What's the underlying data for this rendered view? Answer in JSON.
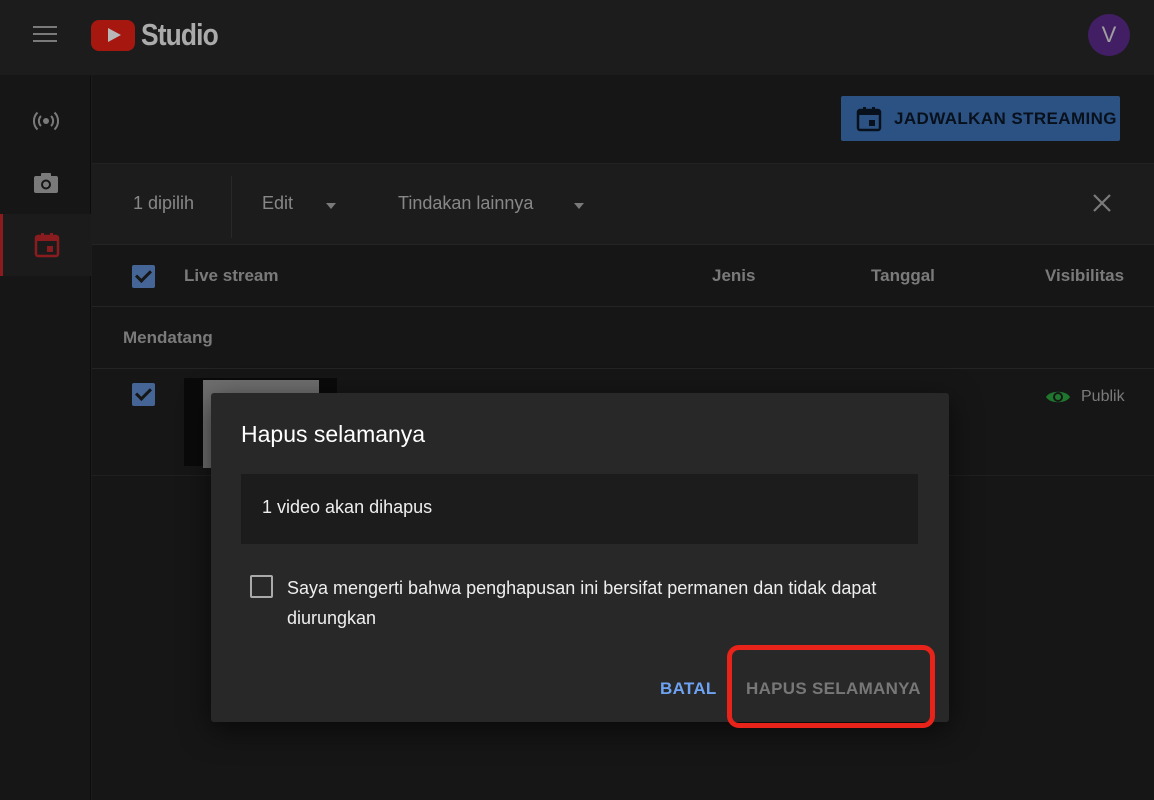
{
  "header": {
    "app_name": "Studio",
    "avatar_initial": "V"
  },
  "rail": {
    "items": [
      {
        "icon": "live-broadcast-icon"
      },
      {
        "icon": "camera-icon"
      },
      {
        "icon": "calendar-icon",
        "active": true
      }
    ]
  },
  "content": {
    "schedule_button": "JADWALKAN STREAMING",
    "toolbar": {
      "selected_count": "1 dipilih",
      "edit": "Edit",
      "more_actions": "Tindakan lainnya"
    },
    "table": {
      "headers": {
        "live_stream": "Live stream",
        "type": "Jenis",
        "date": "Tanggal",
        "visibility": "Visibilitas"
      },
      "section": "Mendatang",
      "row": {
        "visibility": "Publik"
      }
    }
  },
  "dialog": {
    "title": "Hapus selamanya",
    "info": "1 video akan dihapus",
    "confirm_text": "Saya mengerti bahwa penghapusan ini bersifat permanen dan tidak dapat diurungkan",
    "cancel": "BATAL",
    "delete": "HAPUS SELAMANYA"
  },
  "colors": {
    "accent_blue": "#3e72b8",
    "link_blue": "#6ea3f3",
    "highlight_red": "#e8231a",
    "public_green": "#2ba640"
  }
}
